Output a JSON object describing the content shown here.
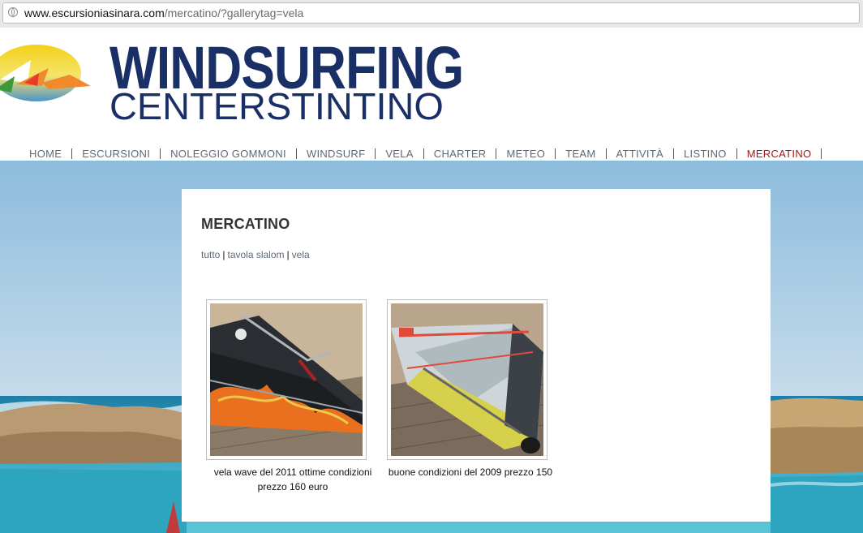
{
  "browser": {
    "url_host": "www.escursioniasinara.com",
    "url_path": "/mercatino/?gallerytag=vela"
  },
  "header": {
    "brand_line1": "WINDSURFING",
    "brand_line2": "CENTERSTINTINO"
  },
  "nav": {
    "items": [
      {
        "label": "HOME"
      },
      {
        "label": "ESCURSIONI"
      },
      {
        "label": "NOLEGGIO GOMMONI"
      },
      {
        "label": "WINDSURF"
      },
      {
        "label": "VELA"
      },
      {
        "label": "CHARTER"
      },
      {
        "label": "METEO"
      },
      {
        "label": "TEAM"
      },
      {
        "label": "ATTIVITÀ"
      },
      {
        "label": "LISTINO"
      },
      {
        "label": "MERCATINO"
      }
    ],
    "active": "MERCATINO"
  },
  "content": {
    "title": "MERCATINO",
    "filters": [
      {
        "label": "tutto"
      },
      {
        "label": "tavola slalom"
      },
      {
        "label": "vela"
      }
    ],
    "separator": "|",
    "gallery": [
      {
        "caption": "vela wave del 2011 ottime condizioni prezzo 160 euro"
      },
      {
        "caption": "buone condizioni del 2009 prezzo 150"
      }
    ]
  },
  "colors": {
    "brand": "#1a2f66",
    "nav_text": "#5a6a7a",
    "nav_active": "#a11b1b",
    "sea": "#3aa6c2",
    "sky": "#7fb4d6"
  }
}
